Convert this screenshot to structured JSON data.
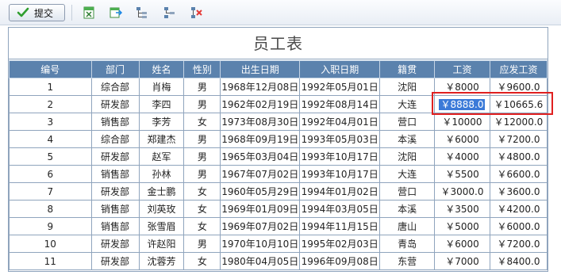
{
  "toolbar": {
    "submit_label": "提交",
    "icons": [
      "excel-export-icon",
      "excel-import-icon",
      "tree-expand-icon",
      "tree-collapse-icon",
      "delete-row-icon"
    ]
  },
  "report": {
    "title": "员工表",
    "columns": [
      "编号",
      "部门",
      "姓名",
      "性别",
      "出生日期",
      "入职日期",
      "籍贯",
      "工资",
      "应发工资"
    ],
    "rows": [
      [
        "1",
        "综合部",
        "肖梅",
        "男",
        "1968年12月08日",
        "1992年05月01日",
        "沈阳",
        "￥8000",
        "￥9600.0"
      ],
      [
        "2",
        "研发部",
        "李四",
        "男",
        "1962年02月19日",
        "1992年08月14日",
        "大连",
        "￥8888.0",
        "￥10665.6"
      ],
      [
        "3",
        "销售部",
        "李芳",
        "女",
        "1973年08月30日",
        "1992年04月01日",
        "营口",
        "￥10000",
        "￥12000.0"
      ],
      [
        "4",
        "综合部",
        "郑建杰",
        "男",
        "1968年09月19日",
        "1993年05月03日",
        "本溪",
        "￥6000",
        "￥7200.0"
      ],
      [
        "5",
        "研发部",
        "赵军",
        "男",
        "1965年03月04日",
        "1993年10月17日",
        "沈阳",
        "￥4000",
        "￥4800.0"
      ],
      [
        "6",
        "销售部",
        "孙林",
        "男",
        "1967年07月02日",
        "1993年10月17日",
        "大连",
        "￥5500",
        "￥6600.0"
      ],
      [
        "7",
        "研发部",
        "金士鹏",
        "女",
        "1960年05月29日",
        "1994年01月02日",
        "营口",
        "￥3000.0",
        "￥3600.0"
      ],
      [
        "8",
        "销售部",
        "刘英玫",
        "女",
        "1969年01月09日",
        "1994年03月05日",
        "本溪",
        "￥3500",
        "￥4200.0"
      ],
      [
        "9",
        "销售部",
        "张雪眉",
        "女",
        "1969年07月02日",
        "1994年11月15日",
        "唐山",
        "￥5000",
        "￥6000.0"
      ],
      [
        "10",
        "研发部",
        "许赵阳",
        "男",
        "1970年10月10日",
        "1995年02月03日",
        "青岛",
        "￥6000",
        "￥7200.0"
      ],
      [
        "11",
        "研发部",
        "沈蓉芳",
        "女",
        "1980年04月05日",
        "1996年09月08日",
        "东营",
        "￥7000",
        "￥8400.0"
      ]
    ],
    "editing_cell": {
      "row": 1,
      "col": 7
    }
  },
  "colors": {
    "header_bg": "#5b82ad",
    "selection_bg": "#3b7ad8",
    "highlight_border": "#e02020",
    "grid_border": "#8fa4bd"
  }
}
